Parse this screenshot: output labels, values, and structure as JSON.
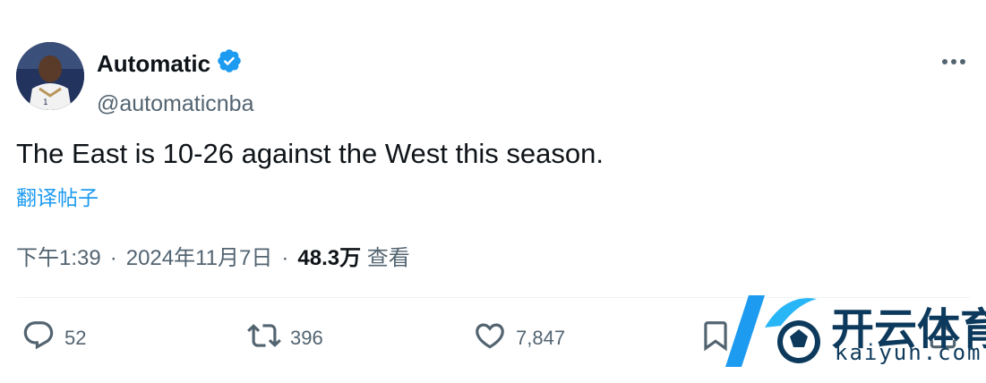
{
  "post": {
    "display_name": "Automatic",
    "handle": "@automaticnba",
    "text": "The East is 10-26 against the West this season.",
    "translate_label": "翻译帖子",
    "time": "下午1:39",
    "date": "2024年11月7日",
    "separator": "·",
    "views_count": "48.3万",
    "views_label": "查看"
  },
  "actions": {
    "replies": "52",
    "reposts": "396",
    "likes": "7,847"
  },
  "watermark": {
    "text_cn": "开云体育",
    "text_en": "kaiyun.com"
  },
  "colors": {
    "verified": "#1d9bf0",
    "link": "#1d9bf0",
    "muted": "#536471",
    "text": "#0f1419"
  },
  "icons": [
    "verified-badge-icon",
    "more-options-icon",
    "reply-icon",
    "repost-icon",
    "like-icon",
    "bookmark-icon",
    "share-icon"
  ]
}
